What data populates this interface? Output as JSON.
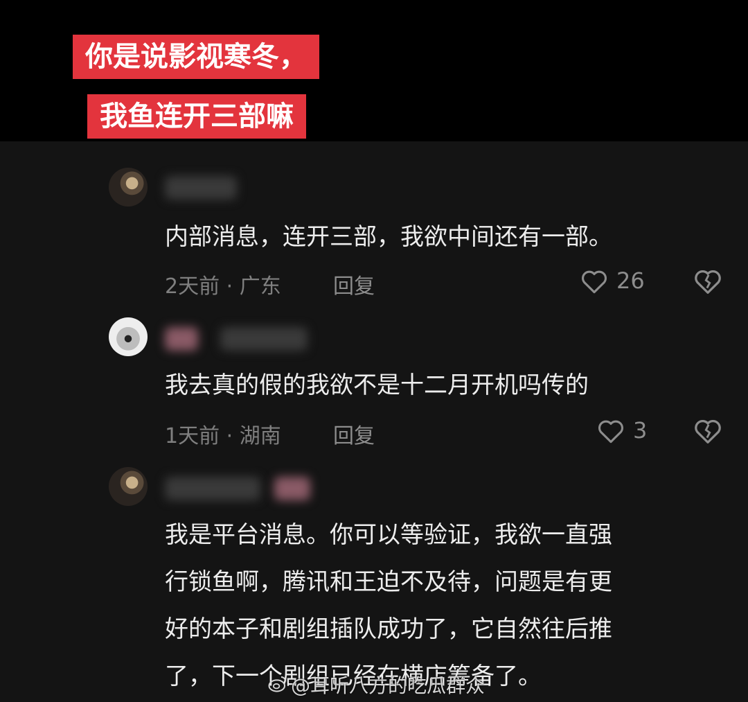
{
  "captions": [
    "你是说影视寒冬，",
    "我鱼连开三部嘛"
  ],
  "comments": [
    {
      "text_lines": [
        "内部消息，连开三部，我欲中间还有一部。"
      ],
      "meta": "2天前 · 广东",
      "reply_label": "回复",
      "likes": "26"
    },
    {
      "text_lines": [
        "我去真的假的我欲不是十二月开机吗传的"
      ],
      "meta": "1天前 · 湖南",
      "reply_label": "回复",
      "likes": "3"
    },
    {
      "text_lines": [
        "我是平台消息。你可以等验证，我欲一直强",
        "行锁鱼啊，腾讯和王迫不及待，问题是有更",
        "好的本子和剧组插队成功了，它自然往后推",
        "了，下一个剧组已经在横店筹备了。"
      ]
    }
  ],
  "watermark": "@耳听八方的吃瓜群众",
  "icons": {
    "like": "heart-outline-icon",
    "dislike": "broken-heart-icon",
    "watermark": "weibo-icon"
  },
  "colors": {
    "caption_bg": "#e3343d",
    "page_bg": "#141414",
    "top_bg": "#000000"
  }
}
